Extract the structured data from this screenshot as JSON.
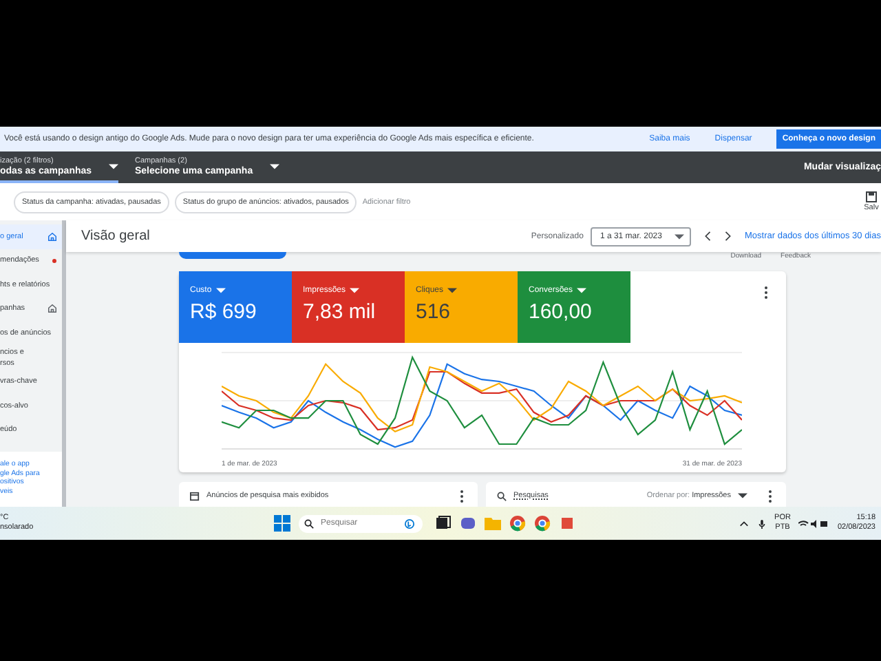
{
  "banner": {
    "message": "Você está usando o design antigo do Google Ads. Mude para o novo design para ter uma experiência do Google Ads mais específica e eficiente.",
    "links": [
      "Saiba mais",
      "Dispensar"
    ],
    "button": "Conheça o novo design"
  },
  "nav_bar": {
    "selectors": [
      {
        "caption": "ização (2 filtros)",
        "value": "odas as campanhas",
        "selected": true
      },
      {
        "caption": "Campanhas (2)",
        "value": "Selecione uma campanha",
        "selected": false
      }
    ],
    "view_button": "Mudar visualizaç"
  },
  "filters": {
    "chips": [
      "Status da campanha: ativadas, pausadas",
      "Status do grupo de anúncios: ativados, pausados"
    ],
    "add_filter": "Adicionar filtro",
    "save_label": "Salv"
  },
  "sidebar": {
    "items": [
      {
        "lines": [
          "o geral"
        ],
        "kind": "home",
        "selected": true
      },
      {
        "lines": [
          "mendações"
        ],
        "kind": "alert",
        "selected": false
      },
      {
        "lines": [
          "hts e relatórios"
        ],
        "kind": "plain",
        "selected": false
      },
      {
        "lines": [
          "panhas"
        ],
        "kind": "home",
        "selected": false
      },
      {
        "lines": [
          "os de anúncios"
        ],
        "kind": "plain",
        "selected": false
      },
      {
        "lines": [
          "ncios e",
          "rsos"
        ],
        "kind": "plain",
        "selected": false
      },
      {
        "lines": [
          "vras-chave"
        ],
        "kind": "plain",
        "selected": false
      },
      {
        "lines": [
          "cos-alvo"
        ],
        "kind": "plain",
        "selected": false
      },
      {
        "lines": [
          "eúdo"
        ],
        "kind": "plain",
        "selected": false
      }
    ],
    "app_promo": [
      "ale o app",
      "gle Ads para",
      "ositivos",
      "veis"
    ]
  },
  "header": {
    "title": "Visão geral",
    "range_label": "Personalizado",
    "date_range": "1 a 31 mar. 2023",
    "link": "Mostrar dados dos últimos 30 dias"
  },
  "header_tools": [
    "Download",
    "Feedback"
  ],
  "metrics": [
    {
      "label": "Custo",
      "value": "R$ 699",
      "color": "#1a73e8"
    },
    {
      "label": "Impressões",
      "value": "7,83 mil",
      "color": "#d93025"
    },
    {
      "label": "Cliques",
      "value": "516",
      "color": "#f9ab00"
    },
    {
      "label": "Conversões",
      "value": "160,00",
      "color": "#1e8e3e"
    }
  ],
  "chart": {
    "start_label": "1 de mar. de 2023",
    "end_label": "31 de mar. de 2023"
  },
  "cards": [
    {
      "kind": "ads",
      "title": "Anúncios de pesquisa mais exibidos"
    },
    {
      "kind": "search",
      "title": "Pesquisas",
      "sort_label": "Ordenar por:",
      "sort_value": "Impressões"
    }
  ],
  "taskbar": {
    "weather": [
      "°C",
      "nsolarado"
    ],
    "search_placeholder": "Pesquisar",
    "language": [
      "POR",
      "PTB"
    ],
    "time": "15:18",
    "date": "02/08/2023"
  }
}
